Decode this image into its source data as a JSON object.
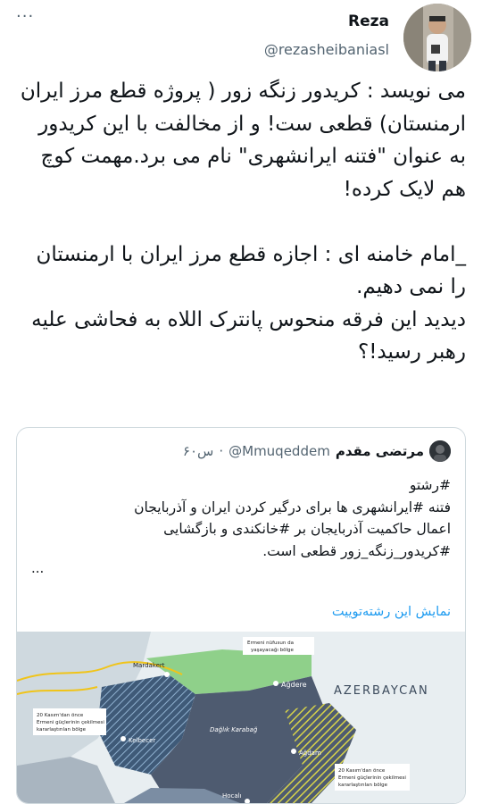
{
  "tweet": {
    "display_name": "Reza",
    "handle": "@rezasheibaniasl",
    "more_icon": "ellipsis-icon",
    "text": "می نویسد : کریدور زنگه زور ( پروژه قطع مرز ایران ارمنستان) قطعی ست! و از مخالفت با این کریدور  به عنوان \"فتنه ایرانشهری\" نام می برد.مهمت کوچ هم لایک کرده!\n\n_امام خامنه ای : اجازه قطع مرز ایران با ارمنستان را نمی دهیم.\nدیدید این فرقه منحوس پانترک اللاه به فحاشی علیه رهبر رسید!؟"
  },
  "quoted": {
    "display_name": "مرتضی مقدم",
    "handle": "@Mmuqeddem",
    "time": "۶۰س",
    "separator": "·",
    "text": "#رشتو\nفتنه #ایرانشهری ها برای درگیر کردن ایران و آذربایجان\nاعمال حاکمیت آذربایجان بر #خانکندی و بازگشایی\n#کریدور_زنگه_زور قطعی است.",
    "ellipsis": "...",
    "show_thread": "نمایش این رشته‌توییت"
  },
  "map": {
    "country_label": "AZERBAYCAN",
    "callout_top": "Ermeni nüfusun da\nyaşayacağı bölge",
    "callout_left": "20 Kasım'dan önce\nErmeni güçlerinin çekilmesi\nkararlaştırılan bölge",
    "callout_right": "20 Kasım'dan önce\nErmeni güçlerinin çekilmesi\nkararlaştırılan bölge",
    "cities": [
      "Mardakert",
      "Ağdere",
      "Kelbecer",
      "Dağlık Karabağ",
      "Ağdam",
      "Hocalı"
    ],
    "colors": {
      "water": "#cfe0e8",
      "land_azerbaijan": "#e8eef1",
      "karabakh": "#4e5b70",
      "kelbecer_hatch": "#3f5a78",
      "agdam_hatch": "#d6d24a",
      "north_zone": "#8fd08a",
      "road": "#f0c419"
    }
  }
}
